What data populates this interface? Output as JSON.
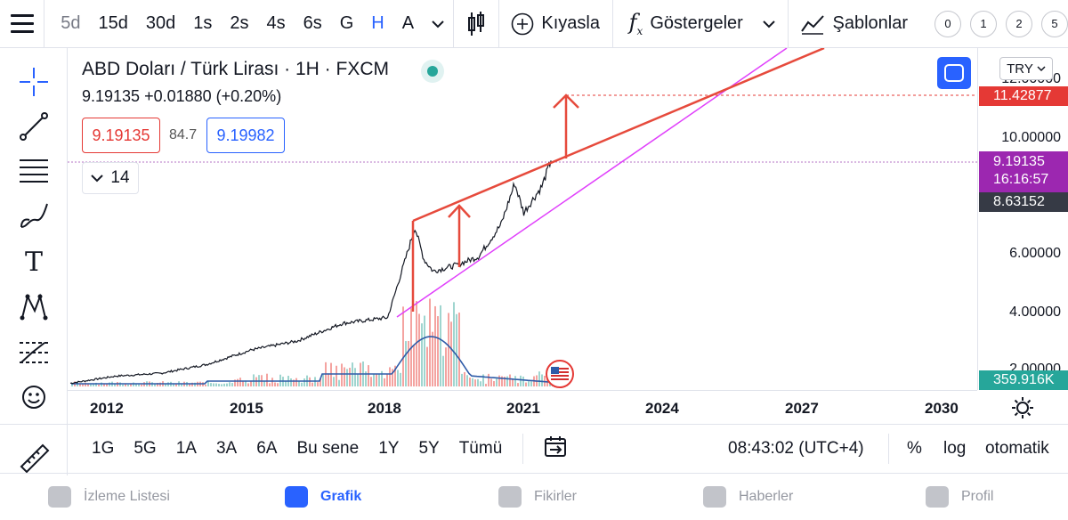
{
  "toolbar": {
    "intervals": [
      {
        "label": "5d",
        "muted": true
      },
      {
        "label": "15d"
      },
      {
        "label": "30d"
      },
      {
        "label": "1s"
      },
      {
        "label": "2s"
      },
      {
        "label": "4s"
      },
      {
        "label": "6s"
      },
      {
        "label": "G"
      },
      {
        "label": "H",
        "active": true
      },
      {
        "label": "A"
      }
    ],
    "compare_label": "Kıyasla",
    "indicators_label": "Göstergeler",
    "templates_label": "Şablonlar",
    "layouts": [
      "0",
      "1",
      "2",
      "5"
    ]
  },
  "legend": {
    "title": "ABD Doları / Türk Lirası · 1H · FXCM",
    "price_line": "9.19135  +0.01880 (+0.20%)",
    "bid": "9.19135",
    "spread": "84.7",
    "ask": "9.19982",
    "indicator_value": "14"
  },
  "currency_select": "TRY",
  "price_axis": {
    "ticks": [
      "12.00000",
      "10.00000",
      "8.00000",
      "6.00000",
      "4.00000",
      "2.00000"
    ],
    "tags": {
      "target": "11.42877",
      "last_price": "9.19135",
      "countdown": "16:16:57",
      "crosshair": "8.63152",
      "volume": "359.916K"
    }
  },
  "time_axis": [
    "2012",
    "2015",
    "2018",
    "2021",
    "2024",
    "2027",
    "2030"
  ],
  "range_bar": {
    "ranges": [
      "1G",
      "5G",
      "1A",
      "3A",
      "6A",
      "Bu sene",
      "1Y",
      "5Y",
      "Tümü"
    ],
    "clock": "08:43:02 (UTC+4)",
    "percent": "%",
    "log": "log",
    "auto": "otomatik"
  },
  "bottom_nav": [
    {
      "label": "İzleme Listesi",
      "icon": "star-icon"
    },
    {
      "label": "Grafik",
      "icon": "chart-icon",
      "active": true
    },
    {
      "label": "Fikirler",
      "icon": "lightbulb-icon"
    },
    {
      "label": "Haberler",
      "icon": "news-icon"
    },
    {
      "label": "Profil",
      "icon": "smile-icon"
    }
  ],
  "colors": {
    "accent": "#2962ff",
    "down": "#e53935",
    "last_price_tag": "#9c27b0",
    "volume_tag": "#26a69a",
    "trendline": "#e64a3c",
    "lower_trendline": "#e040fb"
  },
  "chart_data": {
    "type": "line",
    "x_label": "year",
    "series": [
      {
        "name": "USD/TRY",
        "x": [
          2011,
          2012,
          2013,
          2014,
          2015,
          2016,
          2017,
          2018,
          2018.6,
          2018.8,
          2019,
          2019.5,
          2020,
          2020.5,
          2020.8,
          2021,
          2021.4,
          2021.6
        ],
        "y": [
          1.55,
          1.8,
          1.9,
          2.2,
          2.7,
          3.0,
          3.6,
          3.8,
          6.9,
          5.8,
          5.4,
          5.6,
          5.9,
          7.0,
          8.4,
          7.4,
          8.3,
          9.19
        ]
      }
    ],
    "ylim": [
      1.5,
      13
    ],
    "x_range": [
      2011,
      2031
    ],
    "scale": "log"
  },
  "annotations": {
    "target_price": 11.42877
  }
}
